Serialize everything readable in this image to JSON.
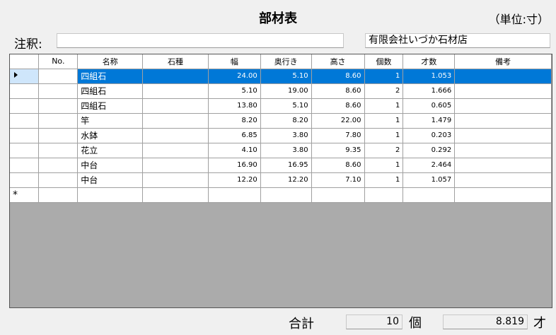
{
  "header": {
    "title": "部材表",
    "unit": "（単位:寸）"
  },
  "form": {
    "note_label": "注釈:",
    "note_value": "",
    "company": "有限会社いづか石材店"
  },
  "table": {
    "columns": [
      "No.",
      "名称",
      "石種",
      "幅",
      "奥行き",
      "高さ",
      "個数",
      "才数",
      "備考"
    ],
    "rows": [
      {
        "no": "",
        "name": "四組石",
        "stone": "",
        "width": "24.00",
        "depth": "5.10",
        "height": "8.60",
        "count": "1",
        "sai": "1.053",
        "note": ""
      },
      {
        "no": "",
        "name": "四組石",
        "stone": "",
        "width": "5.10",
        "depth": "19.00",
        "height": "8.60",
        "count": "2",
        "sai": "1.666",
        "note": ""
      },
      {
        "no": "",
        "name": "四組石",
        "stone": "",
        "width": "13.80",
        "depth": "5.10",
        "height": "8.60",
        "count": "1",
        "sai": "0.605",
        "note": ""
      },
      {
        "no": "",
        "name": "竿",
        "stone": "",
        "width": "8.20",
        "depth": "8.20",
        "height": "22.00",
        "count": "1",
        "sai": "1.479",
        "note": ""
      },
      {
        "no": "",
        "name": "水鉢",
        "stone": "",
        "width": "6.85",
        "depth": "3.80",
        "height": "7.80",
        "count": "1",
        "sai": "0.203",
        "note": ""
      },
      {
        "no": "",
        "name": "花立",
        "stone": "",
        "width": "4.10",
        "depth": "3.80",
        "height": "9.35",
        "count": "2",
        "sai": "0.292",
        "note": ""
      },
      {
        "no": "",
        "name": "中台",
        "stone": "",
        "width": "16.90",
        "depth": "16.95",
        "height": "8.60",
        "count": "1",
        "sai": "2.464",
        "note": ""
      },
      {
        "no": "",
        "name": "中台",
        "stone": "",
        "width": "12.20",
        "depth": "12.20",
        "height": "7.10",
        "count": "1",
        "sai": "1.057",
        "note": ""
      }
    ],
    "new_row_marker": "*"
  },
  "totals": {
    "label": "合計",
    "count": "10",
    "count_unit": "個",
    "sai": "8.819",
    "sai_unit": "才"
  }
}
